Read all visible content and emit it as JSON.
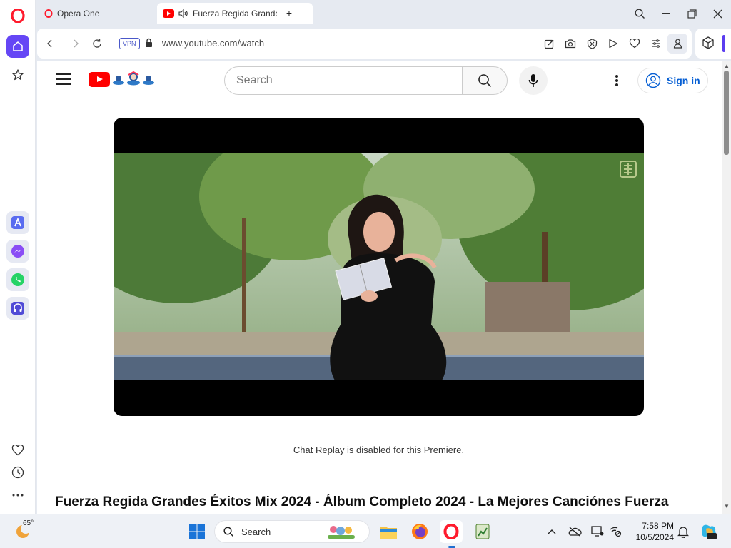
{
  "browser": {
    "tabs": [
      {
        "label": "Opera One"
      },
      {
        "label": "Fuerza Regida Grandes"
      }
    ],
    "vpn_label": "VPN",
    "url": "www.youtube.com/watch"
  },
  "youtube": {
    "search_placeholder": "Search",
    "signin_label": "Sign in",
    "chat_note": "Chat Replay is disabled for this Premiere.",
    "video_title": "Fuerza Regida Grandes Éxitos Mix 2024 - Álbum Completo 2024 - La Mejores Canciónes Fuerza"
  },
  "taskbar": {
    "temperature": "65°",
    "search_label": "Search",
    "time": "7:58 PM",
    "date": "10/5/2024"
  },
  "colors": {
    "accent": "#6546f5",
    "youtube_red": "#ff0000",
    "link_blue": "#065fd4"
  }
}
